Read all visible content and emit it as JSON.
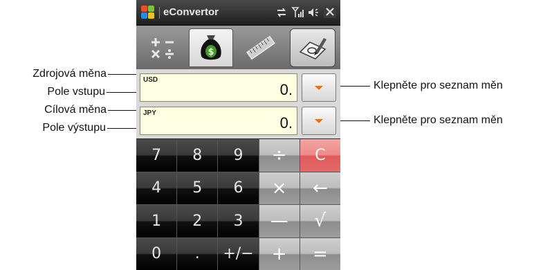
{
  "window": {
    "title": "eConvertor",
    "status_icons": [
      "sync-icon",
      "signal-icon",
      "speaker-icon",
      "close-icon"
    ]
  },
  "tabs": [
    {
      "name": "calculator-tab",
      "icon": "arithmetic-icon"
    },
    {
      "name": "currency-tab",
      "icon": "money-bag-icon",
      "active": true
    },
    {
      "name": "units-tab",
      "icon": "ruler-icon"
    },
    {
      "name": "settings-tab",
      "icon": "edit-settings-icon"
    }
  ],
  "source": {
    "currency_code": "USD",
    "value": "0."
  },
  "target": {
    "currency_code": "JPY",
    "value": "0."
  },
  "keypad": {
    "rows": [
      [
        "7",
        "8",
        "9",
        "÷",
        "C"
      ],
      [
        "4",
        "5",
        "6",
        "×",
        "←"
      ],
      [
        "1",
        "2",
        "3",
        "—",
        "√"
      ],
      [
        "0",
        ".",
        "+/−",
        "+",
        "="
      ]
    ]
  },
  "callouts": {
    "source_currency": "Zdrojová měna",
    "input_field": "Pole vstupu",
    "target_currency": "Cílová měna",
    "output_field": "Pole výstupu",
    "source_list_hint": "Klepněte pro seznam měn",
    "target_list_hint": "Klepněte pro seznam měn"
  },
  "colors": {
    "field_bg": "#fefee2",
    "dropdown_arrow": "#e8701a",
    "clear_key": "#ef8b8b"
  }
}
